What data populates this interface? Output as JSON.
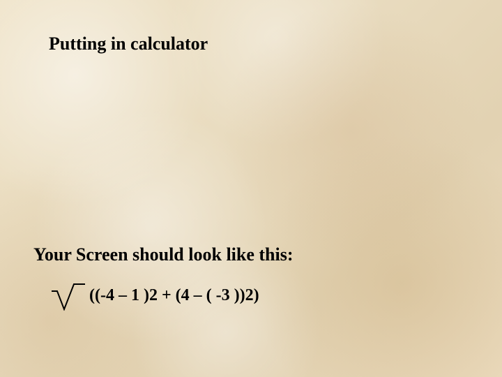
{
  "title": "Putting in calculator",
  "subtitle": "Your Screen should look like this:",
  "formula": "((-4 – 1 )2 + (4 – ( -3 ))2)"
}
